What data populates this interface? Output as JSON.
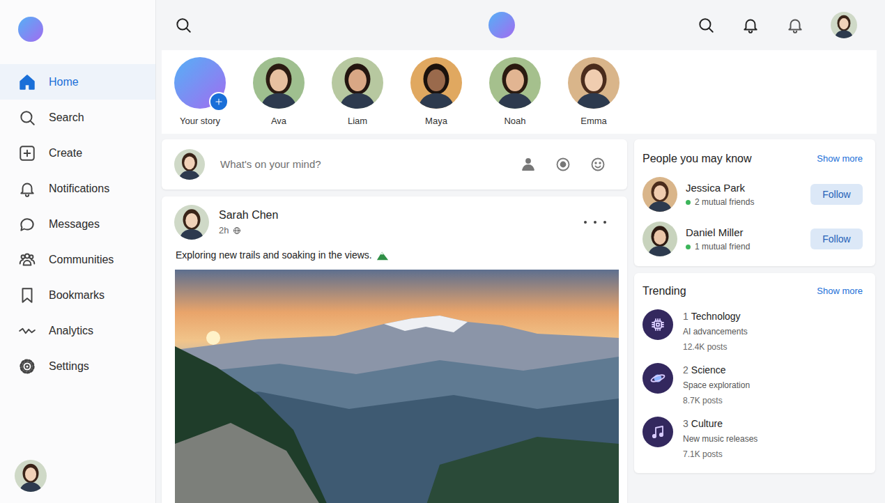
{
  "sidebar": {
    "items": [
      {
        "label": "Home",
        "selected": true
      },
      {
        "label": "Search",
        "selected": false
      },
      {
        "label": "Create",
        "selected": false
      },
      {
        "label": "Notifications",
        "selected": false
      },
      {
        "label": "Messages",
        "selected": false
      },
      {
        "label": "Communities",
        "selected": false
      },
      {
        "label": "Bookmarks",
        "selected": false
      },
      {
        "label": "Analytics",
        "selected": false
      },
      {
        "label": "Settings",
        "selected": false
      }
    ]
  },
  "stories": [
    {
      "name": "Your story",
      "kind": "add"
    },
    {
      "name": "Ava",
      "kind": "friend"
    },
    {
      "name": "Liam",
      "kind": "friend"
    },
    {
      "name": "Maya",
      "kind": "friend"
    },
    {
      "name": "Noah",
      "kind": "friend"
    },
    {
      "name": "Emma",
      "kind": "friend"
    }
  ],
  "composer": {
    "placeholder": "What's on your mind?"
  },
  "post": {
    "author": "Sarah Chen",
    "time": "2h",
    "text": "Exploring new trails and soaking in the views."
  },
  "suggestions": {
    "title": "People you may know",
    "show_more": "Show more",
    "people": [
      {
        "name": "Jessica Park",
        "mutual": "2 mutual friends",
        "button": "Follow"
      },
      {
        "name": "Daniel Miller",
        "mutual": "1 mutual friend",
        "button": "Follow"
      }
    ]
  },
  "trending": {
    "title": "Trending",
    "show_more": "Show more",
    "items": [
      {
        "rank": "1",
        "topic": "Technology",
        "subtitle": "AI advancements",
        "posts": "12.4K posts"
      },
      {
        "rank": "2",
        "topic": "Science",
        "subtitle": "Space exploration",
        "posts": "8.7K posts"
      },
      {
        "rank": "3",
        "topic": "Culture",
        "subtitle": "New music releases",
        "posts": "7.1K posts"
      }
    ]
  }
}
